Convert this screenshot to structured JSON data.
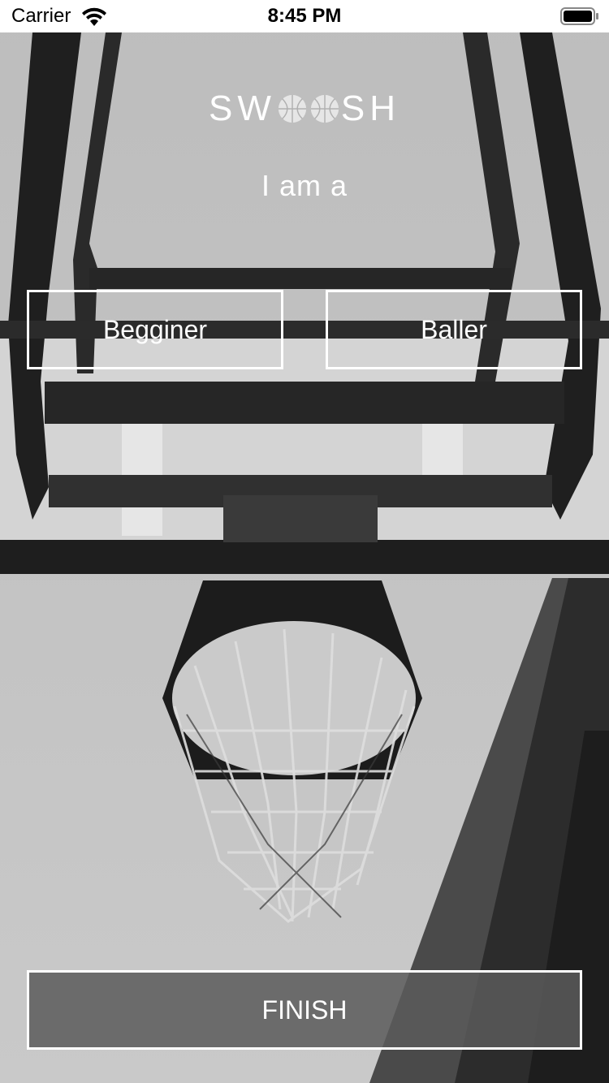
{
  "status_bar": {
    "carrier": "Carrier",
    "time": "8:45 PM",
    "icons": [
      "wifi-icon",
      "battery-icon"
    ]
  },
  "logo": {
    "left": "SW",
    "right": "SH",
    "icon": "basketball-icon"
  },
  "subtitle": "I am a",
  "options": {
    "beginner": "Begginer",
    "baller": "Baller"
  },
  "finish_label": "FINISH",
  "background": {
    "subject": "basketball-hoop-photo",
    "tone": "grayscale"
  },
  "colors": {
    "text": "#ffffff",
    "border": "#ffffff",
    "finish_fill": "#5a5a5a"
  }
}
